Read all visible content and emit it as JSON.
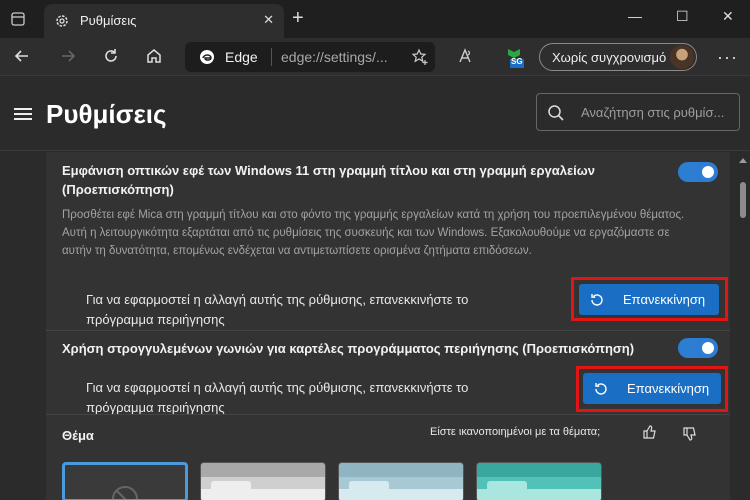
{
  "tab": {
    "title": "Ρυθμίσεις",
    "close": "✕"
  },
  "window": {
    "minimize": "—",
    "maximize": "☐",
    "close": "✕",
    "new_tab": "+"
  },
  "address": {
    "edge_label": "Edge",
    "url": "edge://settings/..."
  },
  "sync": {
    "label": "Χωρίς συγχρονισμό"
  },
  "extension_badge": "SG",
  "page": {
    "title": "Ρυθμίσεις",
    "search_placeholder": "Αναζήτηση στις ρυθμίσ..."
  },
  "settings": [
    {
      "title": "Εμφάνιση οπτικών εφέ των Windows 11 στη γραμμή τίτλου και στη γραμμή εργαλείων (Προεπισκόπηση)",
      "description": "Προσθέτει εφέ Mica στη γραμμή τίτλου και στο φόντο της γραμμής εργαλείων κατά τη χρήση του προεπιλεγμένου θέματος. Αυτή η λειτουργικότητα εξαρτάται από τις ρυθμίσεις της συσκευής και των Windows. Εξακολουθούμε να εργαζόμαστε σε αυτήν τη δυνατότητα, επομένως ενδέχεται να αντιμετωπίσετε ορισμένα ζητήματα επιδόσεων.",
      "enabled": true,
      "restart_text": "Για να εφαρμοστεί η αλλαγή αυτής της ρύθμισης, επανεκκινήστε το πρόγραμμα περιήγησης",
      "restart_button": "Επανεκκίνηση"
    },
    {
      "title": "Χρήση στρογγυλεμένων γωνιών για καρτέλες προγράμματος περιήγησης (Προεπισκόπηση)",
      "enabled": true,
      "restart_text": "Για να εφαρμοστεί η αλλαγή αυτής της ρύθμισης, επανεκκινήστε το πρόγραμμα περιήγησης",
      "restart_button": "Επανεκκίνηση"
    }
  ],
  "theme": {
    "label": "Θέμα",
    "feedback_question": "Είστε ικανοποιημένοι με τα θέματα;"
  },
  "colors": {
    "accent": "#1a6fc4",
    "toggle": "#2d7dd2",
    "highlight": "#e01616"
  }
}
